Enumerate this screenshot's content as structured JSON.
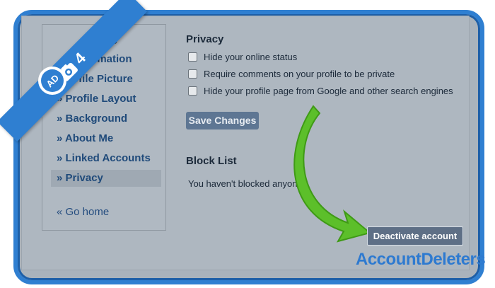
{
  "sidebar": {
    "title_fragment": "gs",
    "items": [
      {
        "label": "Information"
      },
      {
        "label": "ofile Picture"
      },
      {
        "label": "» Profile Layout"
      },
      {
        "label": "» Background"
      },
      {
        "label": "» About Me"
      },
      {
        "label": "» Linked Accounts"
      },
      {
        "label": "» Privacy"
      }
    ],
    "go_home": "« Go home"
  },
  "privacy": {
    "title": "Privacy",
    "options": [
      {
        "label": "Hide your online status",
        "checked": false
      },
      {
        "label": "Require comments on your profile to be private",
        "checked": false
      },
      {
        "label": "Hide your profile page from Google and other search engines",
        "checked": false
      }
    ],
    "save_label": "Save Changes"
  },
  "block_list": {
    "title": "Block List",
    "empty_text": "You haven't blocked anyone"
  },
  "deactivate_label": "Deactivate account",
  "overlay": {
    "step_number": "4",
    "brand": "AccountDeleters"
  },
  "colors": {
    "accent_blue": "#2f7fd1",
    "arrow_green": "#5cbf2a",
    "background_gray": "#aab3bc",
    "button_slate": "#5e7693"
  }
}
